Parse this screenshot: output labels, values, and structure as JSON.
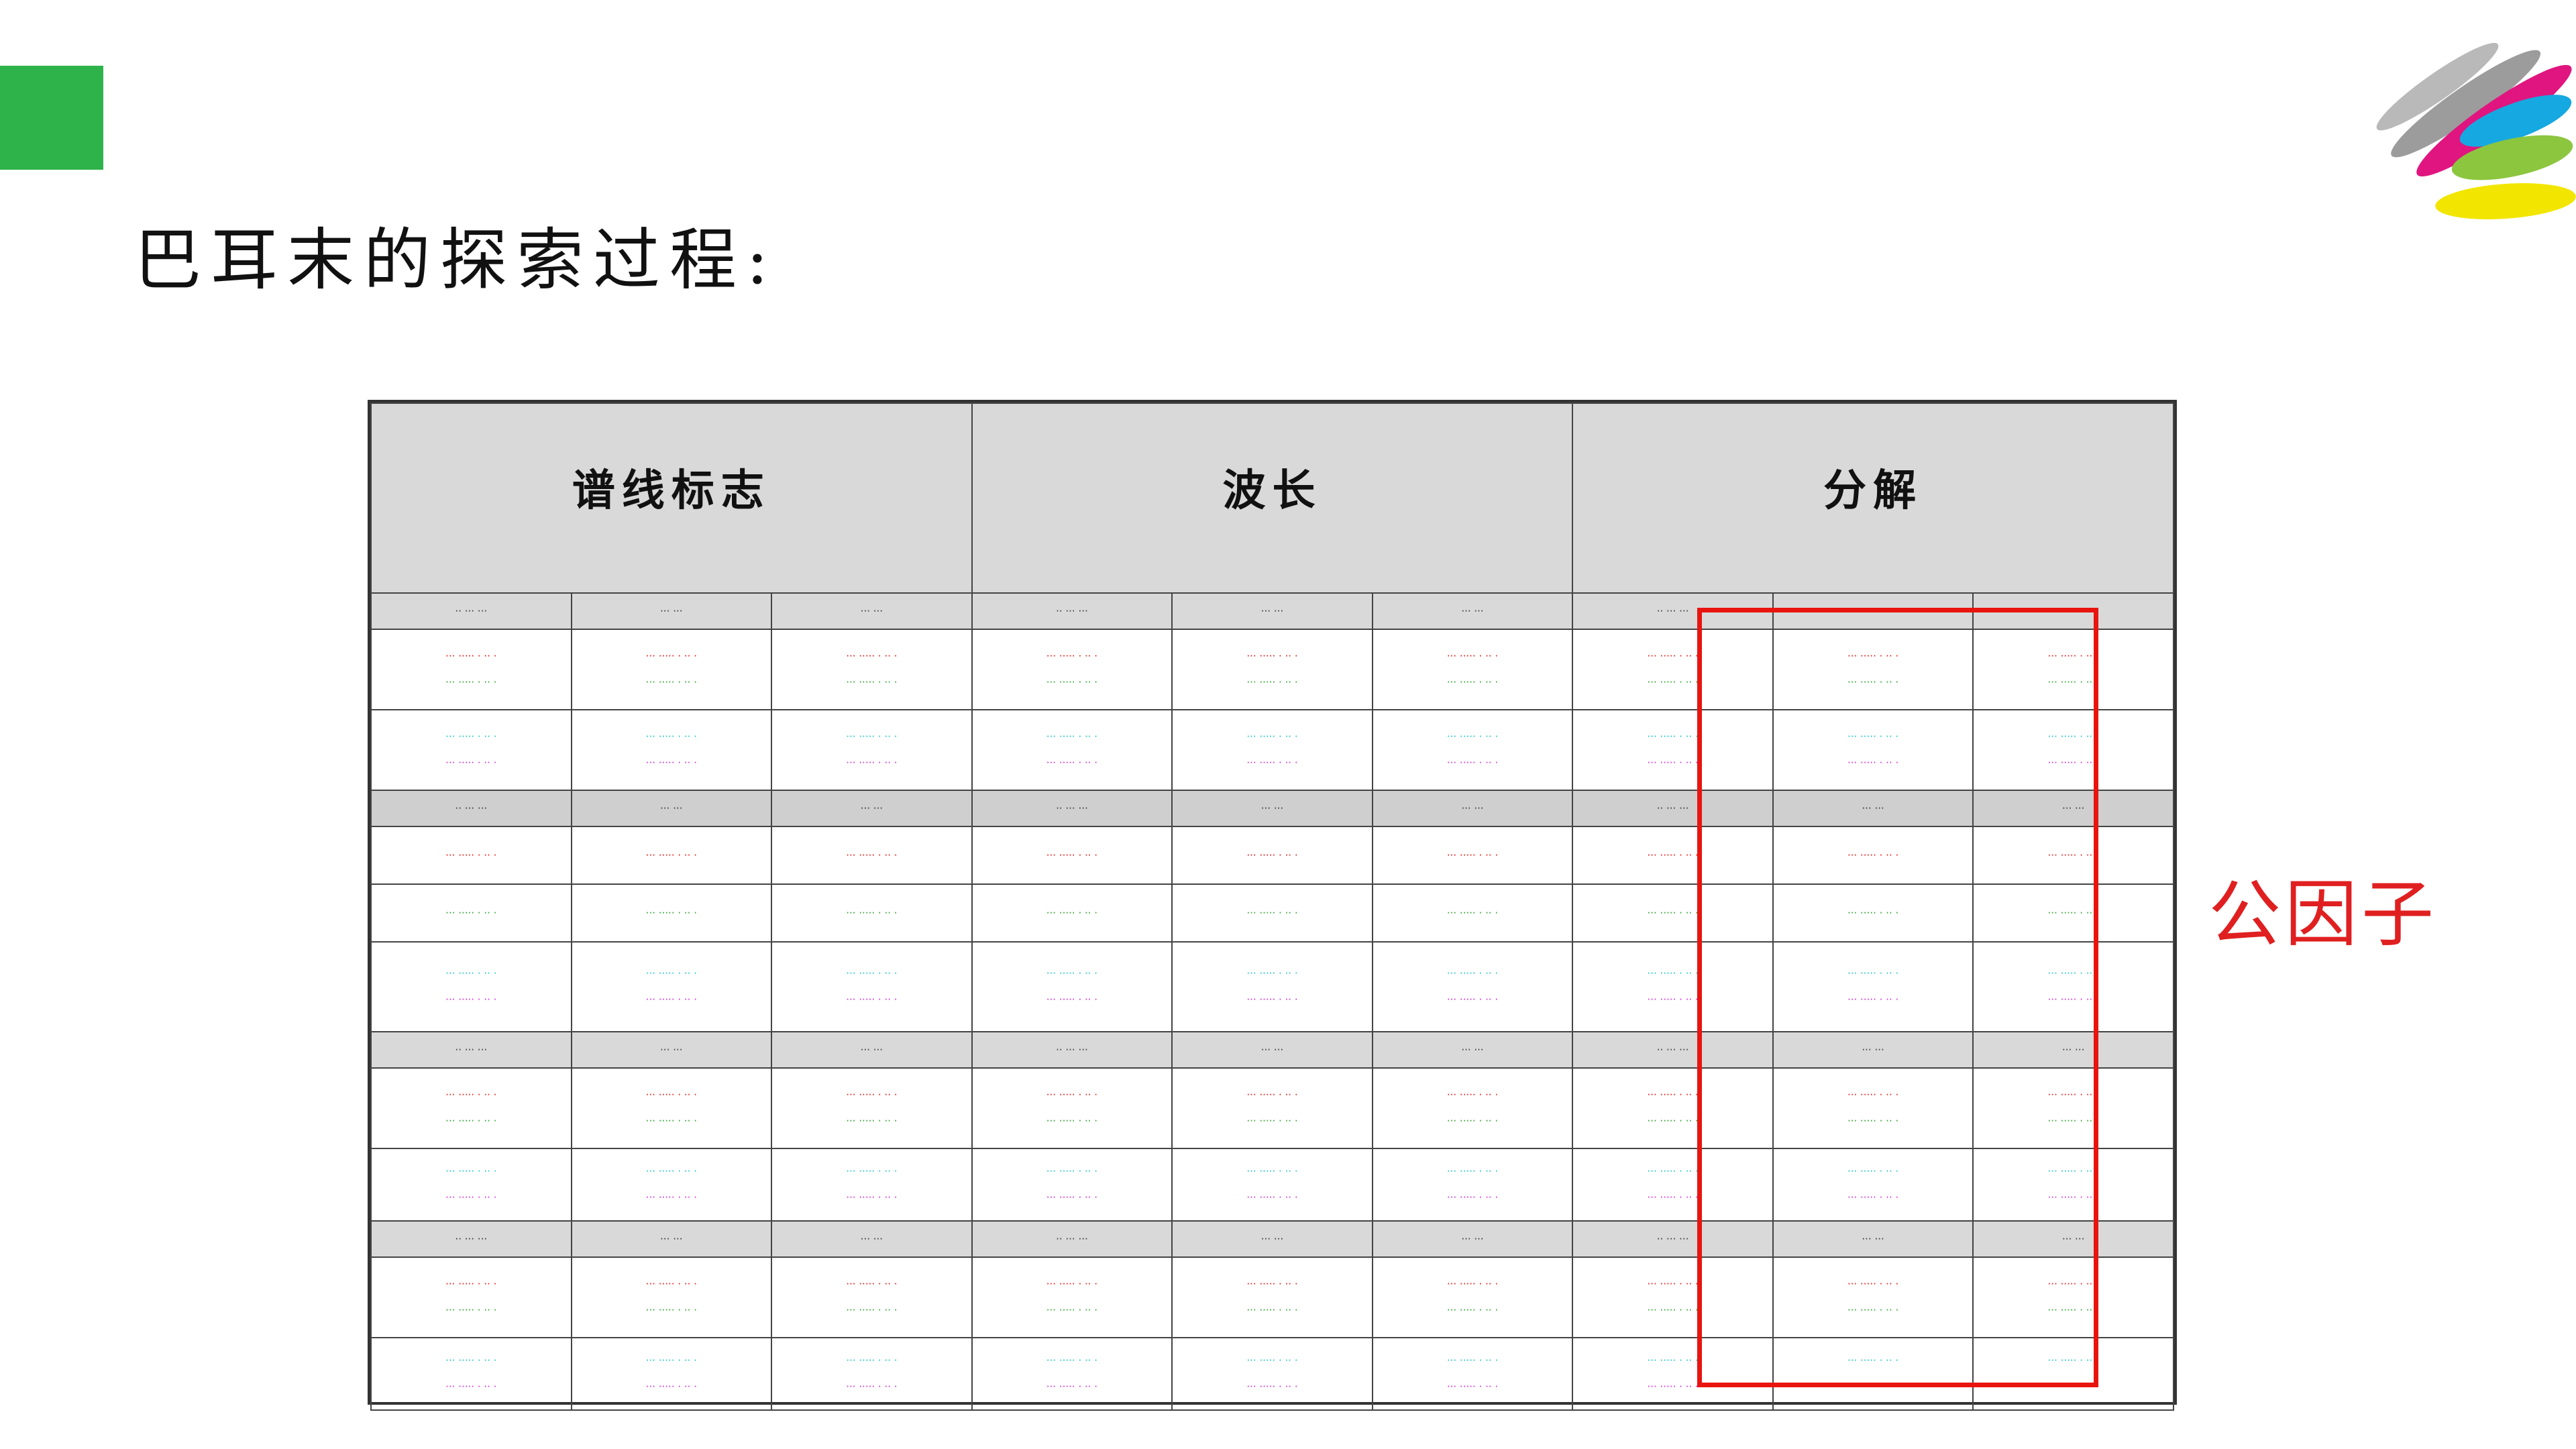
{
  "slide": {
    "title": "巴耳末的探索过程:",
    "accent_color": "#2db34a",
    "annotation": "公因子",
    "annotation_color": "#e02020",
    "highlight_color": "#e8140f"
  },
  "table": {
    "headers": [
      "谱线标志",
      "波长",
      "分解"
    ],
    "sub_headers": [
      "·· ··· ···",
      "··· ···",
      "··· ···"
    ],
    "rows": [
      {
        "type": "sub"
      },
      {
        "type": "data",
        "group": "group-a",
        "colors": [
          "#e8140f",
          "#2aa02a"
        ]
      },
      {
        "type": "data",
        "group": "group-a",
        "colors": [
          "#19c4c4",
          "#d42bd4"
        ]
      },
      {
        "type": "sub",
        "alt": true
      },
      {
        "type": "data",
        "group": "group-c",
        "colors": [
          "#e8140f"
        ]
      },
      {
        "type": "data",
        "group": "group-c",
        "colors": [
          "#2aa02a"
        ]
      },
      {
        "type": "data",
        "group": "group-d",
        "colors": [
          "#19c4c4",
          "#d42bd4"
        ]
      },
      {
        "type": "sub"
      },
      {
        "type": "data",
        "group": "group-a",
        "colors": [
          "#e8140f",
          "#2aa02a"
        ]
      },
      {
        "type": "data",
        "group": "group-b",
        "colors": [
          "#19c4c4",
          "#d42bd4"
        ]
      },
      {
        "type": "sub"
      },
      {
        "type": "data",
        "group": "group-a",
        "colors": [
          "#e8140f",
          "#2aa02a"
        ]
      },
      {
        "type": "data",
        "group": "group-b",
        "colors": [
          "#19c4c4",
          "#d42bd4"
        ]
      }
    ],
    "cell_glyph": "··· ····· · ·· ·"
  }
}
